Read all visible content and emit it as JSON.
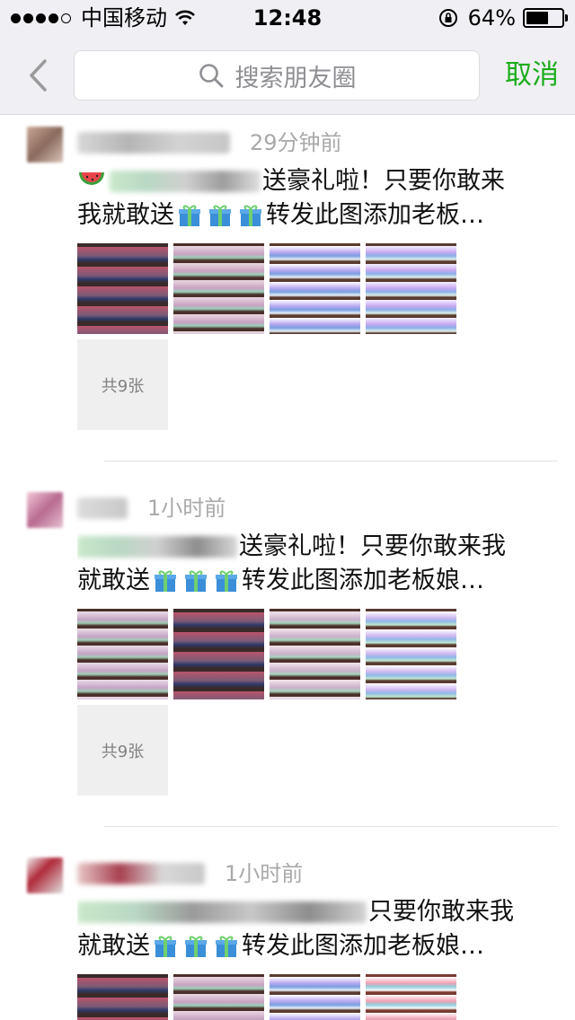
{
  "status_bar": {
    "carrier": "中国移动",
    "time": "12:48",
    "battery_percent_text": "64%",
    "battery_level": 0.64,
    "icons": [
      "signal-dots",
      "wifi-icon",
      "rotation-lock-icon",
      "battery-icon"
    ]
  },
  "header": {
    "search_placeholder": "搜索朋友圈",
    "cancel_label": "取消",
    "accent_color": "#1aad19"
  },
  "posts": [
    {
      "time": "29分钟前",
      "line1_visible": "送豪礼啦！只要你敢来",
      "line2_prefix": "我就敢送",
      "line2_suffix": "转发此图添加老板…",
      "more_label": "共9张"
    },
    {
      "time": "1小时前",
      "line1_visible": "送豪礼啦！只要你敢来我",
      "line2_prefix": "就敢送",
      "line2_suffix": "转发此图添加老板娘…",
      "more_label": "共9张"
    },
    {
      "time": "1小时前",
      "line1_visible": "只要你敢来我",
      "line2_prefix": "就敢送",
      "line2_suffix": "转发此图添加老板娘…"
    }
  ]
}
